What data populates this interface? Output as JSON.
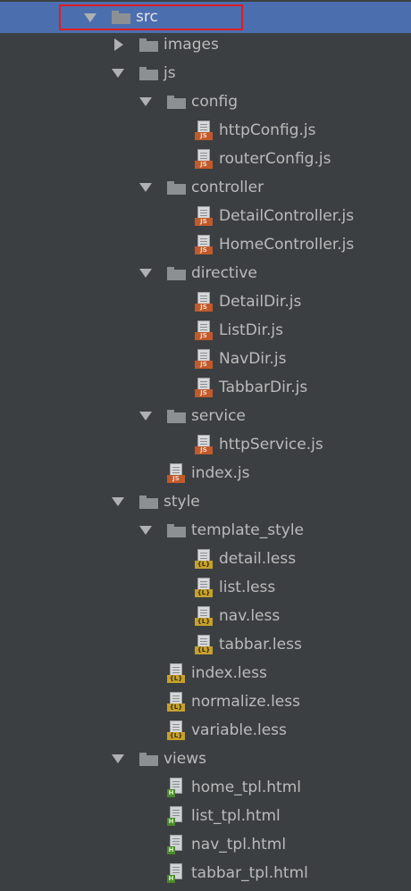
{
  "tree": {
    "rows": [
      {
        "label": "src",
        "type": "folder",
        "arrow": "down",
        "selected": true
      },
      {
        "label": "images",
        "type": "folder",
        "arrow": "right"
      },
      {
        "label": "js",
        "type": "folder",
        "arrow": "down"
      },
      {
        "label": "config",
        "type": "folder",
        "arrow": "down"
      },
      {
        "label": "httpConfig.js",
        "type": "js"
      },
      {
        "label": "routerConfig.js",
        "type": "js"
      },
      {
        "label": "controller",
        "type": "folder",
        "arrow": "down"
      },
      {
        "label": "DetailController.js",
        "type": "js"
      },
      {
        "label": "HomeController.js",
        "type": "js"
      },
      {
        "label": "directive",
        "type": "folder",
        "arrow": "down"
      },
      {
        "label": "DetailDir.js",
        "type": "js"
      },
      {
        "label": "ListDir.js",
        "type": "js"
      },
      {
        "label": "NavDir.js",
        "type": "js"
      },
      {
        "label": "TabbarDir.js",
        "type": "js"
      },
      {
        "label": "service",
        "type": "folder",
        "arrow": "down"
      },
      {
        "label": "httpService.js",
        "type": "js"
      },
      {
        "label": "index.js",
        "type": "js"
      },
      {
        "label": "style",
        "type": "folder",
        "arrow": "down"
      },
      {
        "label": "template_style",
        "type": "folder",
        "arrow": "down"
      },
      {
        "label": "detail.less",
        "type": "less"
      },
      {
        "label": "list.less",
        "type": "less"
      },
      {
        "label": "nav.less",
        "type": "less"
      },
      {
        "label": "tabbar.less",
        "type": "less"
      },
      {
        "label": "index.less",
        "type": "less"
      },
      {
        "label": "normalize.less",
        "type": "less"
      },
      {
        "label": "variable.less",
        "type": "less"
      },
      {
        "label": "views",
        "type": "folder",
        "arrow": "down"
      },
      {
        "label": "home_tpl.html",
        "type": "html"
      },
      {
        "label": "list_tpl.html",
        "type": "html"
      },
      {
        "label": "nav_tpl.html",
        "type": "html"
      },
      {
        "label": "tabbar_tpl.html",
        "type": "html"
      }
    ]
  },
  "badges": {
    "js": "JS",
    "less": "{L}",
    "html": "H"
  },
  "colors": {
    "background": "#3c3f41",
    "selection": "#4b6eaf",
    "highlight_box": "#e01b24",
    "text": "#bbbbbb",
    "js_badge": "#c05a2b",
    "less_badge": "#c6a12d",
    "html_badge": "#4a8a2a"
  }
}
